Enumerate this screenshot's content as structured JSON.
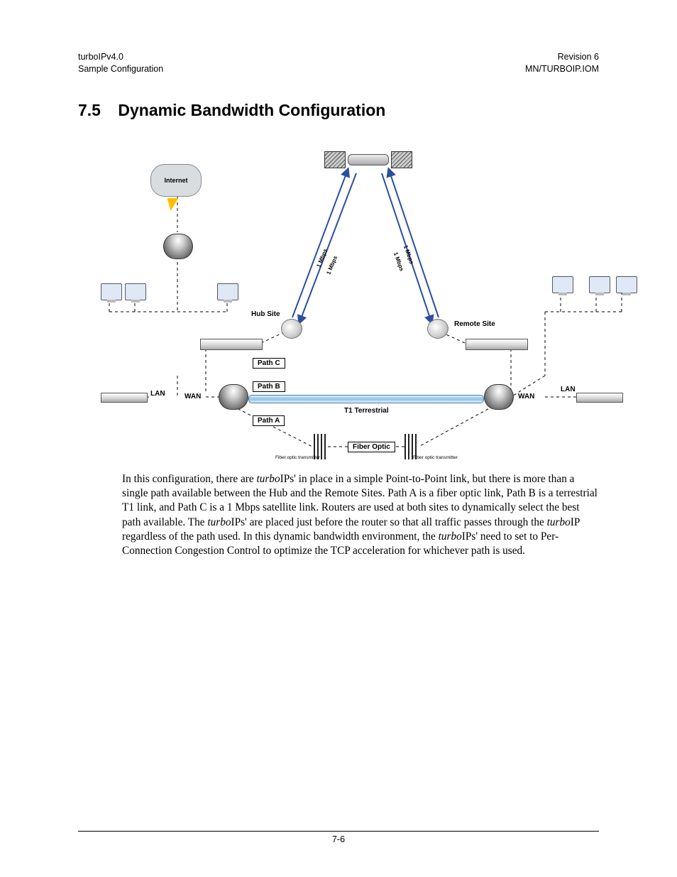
{
  "header": {
    "left1": "turboIPv4.0",
    "left2": "Sample Configuration",
    "right1": "Revision 6",
    "right2": "MN/TURBOIP.IOM"
  },
  "section": {
    "number": "7.5",
    "title": "Dynamic Bandwidth Configuration"
  },
  "diagram": {
    "internet": "Internet",
    "hub_site": "Hub Site",
    "remote_site": "Remote Site",
    "lan_left": "LAN",
    "wan_left": "WAN",
    "lan_right": "LAN",
    "wan_right": "WAN",
    "path_a": "Path A",
    "path_b": "Path B",
    "path_c": "Path C",
    "t1": "T1 Terrestrial",
    "fiber": "Fiber Optic",
    "fiber_tx_left": "Fiber optic transmitter",
    "fiber_tx_right": "Fiber optic transmitter",
    "mbps_up_left": "1 Mbps",
    "mbps_down_left": "1 Mbps",
    "mbps_up_right": "1 Mbps",
    "mbps_down_right": "1 Mbps"
  },
  "paragraph": {
    "text1a": "In this configuration, there are ",
    "em1": "turbo",
    "text1b": "IPs' in place in a simple Point-to-Point link, but there is more than a single path available between the Hub and the Remote Sites. Path A is a fiber optic link, Path B is a terrestrial T1 link, and Path C is a 1 Mbps satellite link. Routers are used at both sites to dynamically select the best path available. The ",
    "em2": "turbo",
    "text1c": "IPs' are placed just before the router so that all traffic passes through the ",
    "em3": "turbo",
    "text1d": "IP regardless of the path used. In this dynamic bandwidth environment, the ",
    "em4": "turbo",
    "text1e": "IPs' need to set to Per-Connection Congestion Control to optimize the TCP acceleration for whichever path is used."
  },
  "footer": {
    "page": "7-6"
  }
}
